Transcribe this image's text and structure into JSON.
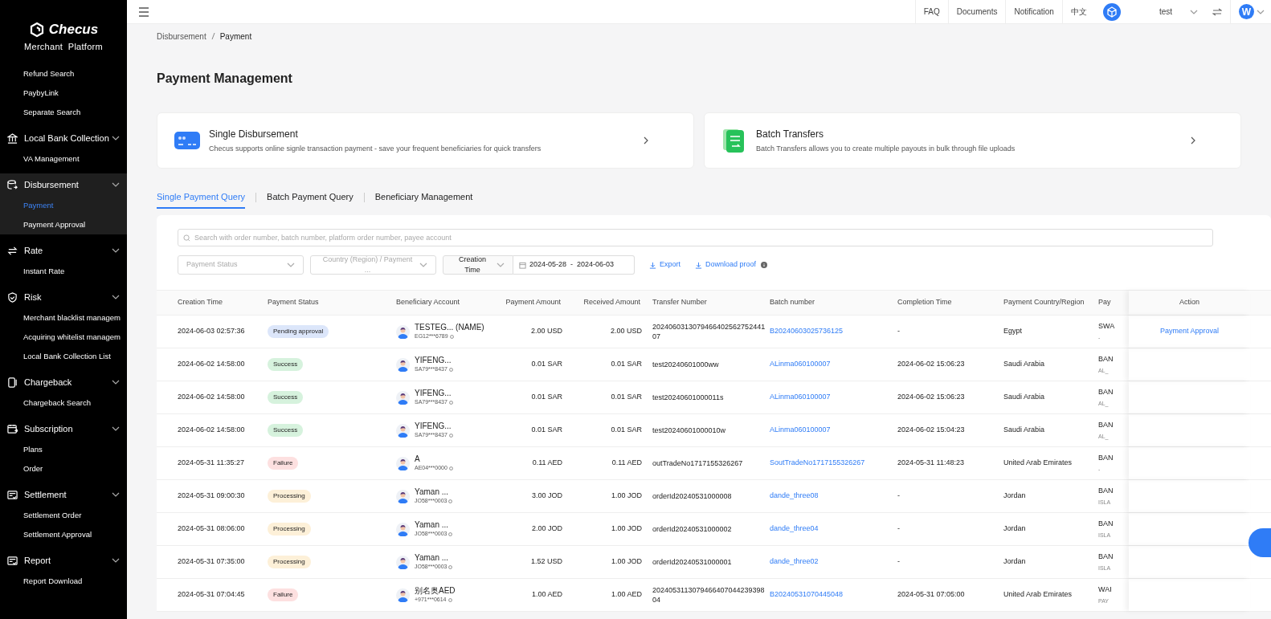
{
  "logo": {
    "name": "Checus",
    "subtitle": "Merchant  Platform"
  },
  "sidebar": {
    "items": [
      {
        "kind": "link",
        "label": "Refund Search",
        "selected": false
      },
      {
        "kind": "link",
        "label": "PaybyLink",
        "selected": false
      },
      {
        "kind": "link",
        "label": "Separate Search",
        "selected": false
      },
      {
        "kind": "group",
        "label": "Local Bank Collection",
        "expanded": true,
        "selected": false
      },
      {
        "kind": "link",
        "label": "VA Management",
        "selected": false
      },
      {
        "kind": "group",
        "label": "Disbursement",
        "expanded": true,
        "selected": true
      },
      {
        "kind": "link",
        "label": "Payment",
        "selected": true
      },
      {
        "kind": "link",
        "label": "Payment Approval",
        "selected": false
      },
      {
        "kind": "group",
        "label": "Rate",
        "expanded": true,
        "selected": false
      },
      {
        "kind": "link",
        "label": "Instant Rate",
        "selected": false
      },
      {
        "kind": "group",
        "label": "Risk",
        "expanded": true,
        "selected": false
      },
      {
        "kind": "link",
        "label": "Merchant blacklist managem",
        "selected": false
      },
      {
        "kind": "link",
        "label": "Acquiring whitelist managem",
        "selected": false
      },
      {
        "kind": "link",
        "label": "Local Bank Collection List",
        "selected": false
      },
      {
        "kind": "group",
        "label": "Chargeback",
        "expanded": true,
        "selected": false
      },
      {
        "kind": "link",
        "label": "Chargeback Search",
        "selected": false
      },
      {
        "kind": "group",
        "label": "Subscription",
        "expanded": true,
        "selected": false
      },
      {
        "kind": "link",
        "label": "Plans",
        "selected": false
      },
      {
        "kind": "link",
        "label": "Order",
        "selected": false
      },
      {
        "kind": "group",
        "label": "Settlement",
        "expanded": true,
        "selected": false
      },
      {
        "kind": "link",
        "label": "Settlement Order",
        "selected": false
      },
      {
        "kind": "link",
        "label": "Settlement Approval",
        "selected": false
      },
      {
        "kind": "group",
        "label": "Report",
        "expanded": true,
        "selected": false
      },
      {
        "kind": "link",
        "label": "Report Download",
        "selected": false
      }
    ]
  },
  "topbar": {
    "links": [
      "FAQ",
      "Documents",
      "Notification",
      "中文"
    ],
    "user": "test",
    "avatar": "W"
  },
  "breadcrumb": [
    "Disbursement",
    "Payment"
  ],
  "title": "Payment Management",
  "cards": [
    {
      "kind": "card",
      "title": "Single Disbursement",
      "text": "Checus supports online signle transaction payment - save your frequent beneficiaries for quick transfers"
    },
    {
      "kind": "doc",
      "title": "Batch Transfers",
      "text": "Batch Transfers allows you to create multiple payouts in bulk through file uploads"
    }
  ],
  "tabs": [
    {
      "label": "Single Payment Query",
      "selected": true
    },
    {
      "label": "Batch Payment Query",
      "selected": false
    },
    {
      "label": "Beneficiary Management",
      "selected": false
    }
  ],
  "search": {
    "placeholder": "Search with order number, batch number, platform order number, payee account"
  },
  "filters": {
    "status_placeholder": "Payment Status",
    "country_placeholder": "Country (Region) / Payment ...",
    "time_type": "Creation Time",
    "date_from": "2024-05-28",
    "date_sep": "-",
    "date_to": "2024-06-03",
    "export": "Export",
    "download": "Download proof"
  },
  "table": {
    "columns": [
      "Creation Time",
      "Payment Status",
      "Beneficiary Account",
      "Payment Amount",
      "Received Amount",
      "Transfer Number",
      "Batch number",
      "Completion Time",
      "Payment Country/Region",
      "Pay",
      "Action"
    ],
    "rows": [
      {
        "created": "2024-06-03 02:57:36",
        "status": "Pending approval",
        "kind": "pending",
        "name": "TESTEG... (NAME)",
        "account": "EG12***6789",
        "amount": "2.00 USD",
        "received": "2.00 USD",
        "transfer": "202406031307946640256275244107",
        "batch": "B20240603025736125",
        "completed": "-",
        "country": "Egypt",
        "pay_1": "SWA",
        "pay_2": "-",
        "action": "Payment Approval"
      },
      {
        "created": "2024-06-02 14:58:00",
        "status": "Success",
        "kind": "success",
        "name": "YIFENG...",
        "account": "SA79***8437",
        "amount": "0.01 SAR",
        "received": "0.01 SAR",
        "transfer": "test20240601000ww",
        "batch": "ALinma060100007",
        "completed": "2024-06-02 15:06:23",
        "country": "Saudi Arabia",
        "pay_1": "BAN",
        "pay_2": "AL_"
      },
      {
        "created": "2024-06-02 14:58:00",
        "status": "Success",
        "kind": "success",
        "name": "YIFENG...",
        "account": "SA79***8437",
        "amount": "0.01 SAR",
        "received": "0.01 SAR",
        "transfer": "test20240601000011s",
        "batch": "ALinma060100007",
        "completed": "2024-06-02 15:06:23",
        "country": "Saudi Arabia",
        "pay_1": "BAN",
        "pay_2": "AL_"
      },
      {
        "created": "2024-06-02 14:58:00",
        "status": "Success",
        "kind": "success",
        "name": "YIFENG...",
        "account": "SA79***8437",
        "amount": "0.01 SAR",
        "received": "0.01 SAR",
        "transfer": "test20240601000010w",
        "batch": "ALinma060100007",
        "completed": "2024-06-02 15:04:23",
        "country": "Saudi Arabia",
        "pay_1": "BAN",
        "pay_2": "AL_"
      },
      {
        "created": "2024-05-31 11:35:27",
        "status": "Failure",
        "kind": "failure",
        "name": "A",
        "account": "AE04***0000",
        "amount": "0.11 AED",
        "received": "0.11 AED",
        "transfer": "outTradeNo1717155326267",
        "batch": "SoutTradeNo1717155326267",
        "completed": "2024-05-31 11:48:23",
        "country": "United Arab Emirates",
        "pay_1": "BAN",
        "pay_2": "-"
      },
      {
        "created": "2024-05-31 09:00:30",
        "status": "Processing",
        "kind": "processing",
        "name": "Yaman ...",
        "account": "JO58***0003",
        "amount": "3.00 JOD",
        "received": "1.00 JOD",
        "transfer": "orderId20240531000008",
        "batch": "dande_three08",
        "completed": "-",
        "country": "Jordan",
        "pay_1": "BAN",
        "pay_2": "ISLA"
      },
      {
        "created": "2024-05-31 08:06:00",
        "status": "Processing",
        "kind": "processing",
        "name": "Yaman ...",
        "account": "JO58***0003",
        "amount": "2.00 JOD",
        "received": "1.00 JOD",
        "transfer": "orderId20240531000002",
        "batch": "dande_three04",
        "completed": "-",
        "country": "Jordan",
        "pay_1": "BAN",
        "pay_2": "ISLA"
      },
      {
        "created": "2024-05-31 07:35:00",
        "status": "Processing",
        "kind": "processing",
        "name": "Yaman ...",
        "account": "JO58***0003",
        "amount": "1.52 USD",
        "received": "1.00 JOD",
        "transfer": "orderId20240531000001",
        "batch": "dande_three02",
        "completed": "-",
        "country": "Jordan",
        "pay_1": "BAN",
        "pay_2": "ISLA"
      },
      {
        "created": "2024-05-31 07:04:45",
        "status": "Failure",
        "kind": "failure",
        "name": "别名奥AED",
        "account": "+971***0614",
        "amount": "1.00 AED",
        "received": "1.00 AED",
        "transfer": "2024053113079466407044239398 04",
        "batch": "B20240531070445048",
        "completed": "2024-05-31 07:05:00",
        "country": "United Arab Emirates",
        "pay_1": "WAI",
        "pay_2": "PAY"
      }
    ]
  }
}
